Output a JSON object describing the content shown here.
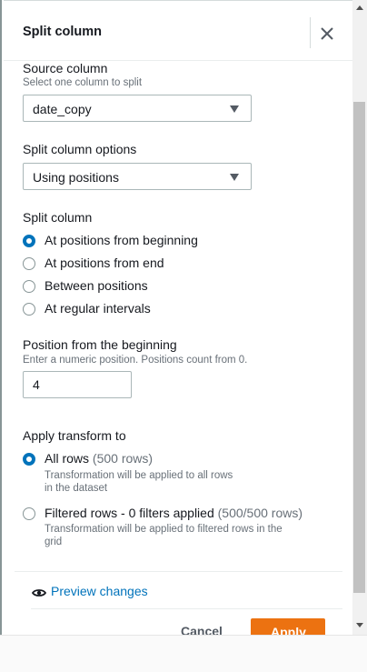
{
  "panel": {
    "title": "Split column"
  },
  "source_column": {
    "label": "Source column",
    "hint": "Select one column to split",
    "selected": "date_copy"
  },
  "split_options": {
    "label": "Split column options",
    "selected": "Using positions"
  },
  "split_column": {
    "label": "Split column",
    "options": [
      {
        "label": "At positions from beginning",
        "checked": true
      },
      {
        "label": "At positions from end",
        "checked": false
      },
      {
        "label": "Between positions",
        "checked": false
      },
      {
        "label": "At regular intervals",
        "checked": false
      }
    ]
  },
  "position": {
    "label": "Position from the beginning",
    "hint": "Enter a numeric position. Positions count from 0.",
    "value": "4"
  },
  "apply_to": {
    "label": "Apply transform to",
    "all_rows": {
      "label": "All rows",
      "count": "(500 rows)",
      "desc_line1": "Transformation will be applied to all rows",
      "desc_line2": "in the dataset",
      "checked": true
    },
    "filtered_rows": {
      "label": "Filtered rows - 0 filters applied",
      "count": "(500/500 rows)",
      "desc_line1": "Transformation will be applied to filtered rows in the",
      "desc_line2": "grid",
      "checked": false
    }
  },
  "footer": {
    "preview_label": "Preview changes",
    "cancel_label": "Cancel",
    "apply_label": "Apply"
  },
  "colors": {
    "accent": "#0073bb",
    "primary_button": "#ec7211"
  },
  "icons": {
    "close": "close-icon",
    "preview": "eye-icon",
    "dropdown": "caret-down-icon"
  }
}
